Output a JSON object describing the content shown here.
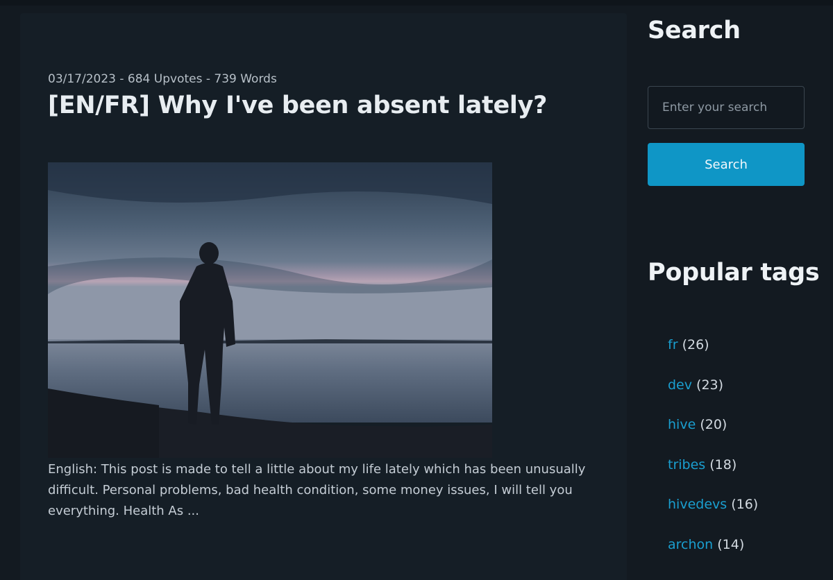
{
  "post": {
    "meta": "03/17/2023 - 684 Upvotes - 739 Words",
    "title": "[EN/FR] Why I've been absent lately?",
    "excerpt": "English: This post is made to tell a little about my life lately which has been unusually difficult. Personal problems, bad health condition, some money issues, I will tell you everything. Health As ..."
  },
  "sidebar": {
    "search_heading": "Search",
    "search_placeholder": "Enter your search",
    "search_button": "Search",
    "tags_heading": "Popular tags",
    "tags": [
      {
        "name": "fr",
        "count": "(26)"
      },
      {
        "name": "dev",
        "count": "(23)"
      },
      {
        "name": "hive",
        "count": "(20)"
      },
      {
        "name": "tribes",
        "count": "(18)"
      },
      {
        "name": "hivedevs",
        "count": "(16)"
      },
      {
        "name": "archon",
        "count": "(14)"
      }
    ]
  },
  "colors": {
    "background": "#131a21",
    "card": "#151e26",
    "accent": "#0f96c6",
    "link": "#1a9fd0"
  }
}
